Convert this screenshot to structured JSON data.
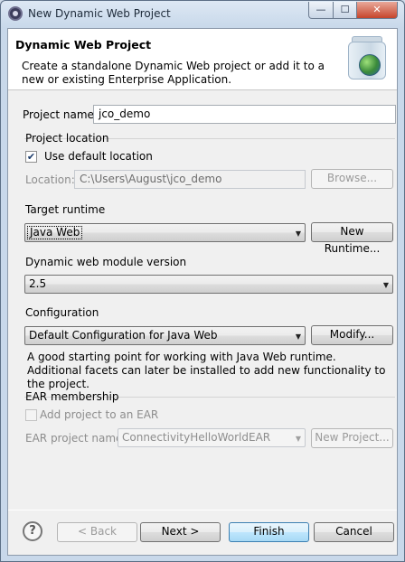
{
  "window": {
    "title": "New Dynamic Web Project",
    "controls": {
      "minimize": "—",
      "maximize": "☐",
      "close": "✕"
    }
  },
  "banner": {
    "title": "Dynamic Web Project",
    "description": "Create a standalone Dynamic Web project or add it to a new or existing Enterprise Application.",
    "image_icon": "jar-globe-icon"
  },
  "project_name": {
    "label": "Project name:",
    "value": "jco_demo"
  },
  "project_location": {
    "group_title": "Project location",
    "use_default_label": "Use default location",
    "use_default_checked": true,
    "location_label": "Location:",
    "location_value": "C:\\Users\\August\\jco_demo",
    "browse_label": "Browse..."
  },
  "target_runtime": {
    "group_title": "Target runtime",
    "selected": "Java Web",
    "new_runtime_label": "New Runtime..."
  },
  "module_version": {
    "group_title": "Dynamic web module version",
    "selected": "2.5"
  },
  "configuration": {
    "group_title": "Configuration",
    "selected": "Default Configuration for Java Web",
    "modify_label": "Modify...",
    "description": "A good starting point for working with Java Web runtime. Additional facets can later be installed to add new functionality to the project."
  },
  "ear": {
    "group_title": "EAR membership",
    "add_label": "Add project to an EAR",
    "add_checked": false,
    "ear_name_label": "EAR project name:",
    "ear_name_value": "ConnectivityHelloWorldEAR",
    "new_project_label": "New Project..."
  },
  "footer": {
    "help_glyph": "?",
    "back_label": "< Back",
    "next_label": "Next >",
    "finish_label": "Finish",
    "cancel_label": "Cancel"
  }
}
